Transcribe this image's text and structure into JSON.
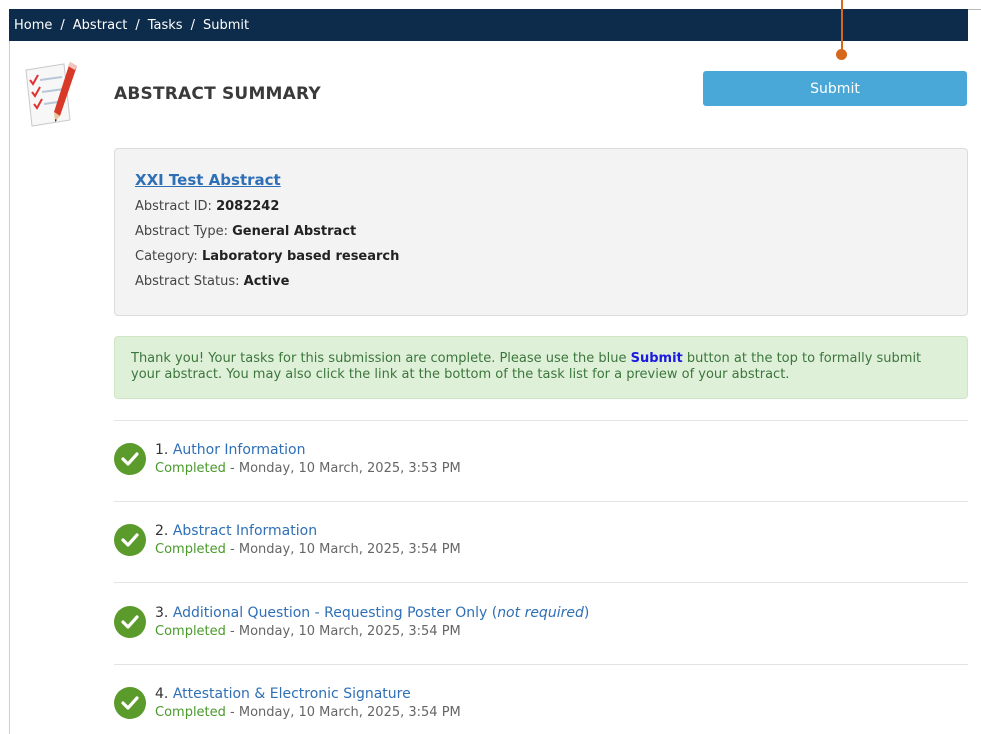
{
  "breadcrumb": [
    {
      "label": "Home"
    },
    {
      "label": "Abstract"
    },
    {
      "label": "Tasks"
    },
    {
      "label": "Submit"
    }
  ],
  "breadcrumb_separator": "/",
  "page_title": "ABSTRACT SUMMARY",
  "submit_button": "Submit",
  "summary": {
    "title_link": "XXI Test Abstract",
    "abstract_id_label": "Abstract ID:",
    "abstract_id": "2082242",
    "type_label": "Abstract Type:",
    "type": "General Abstract",
    "category_label": "Category:",
    "category": "Laboratory based research",
    "status_label": "Abstract Status:",
    "status": "Active"
  },
  "notice": {
    "before": "Thank you! Your tasks for this submission are complete. Please use the blue ",
    "highlight": "Submit",
    "after": " button at the top to formally submit your abstract. You may also click the link at the bottom of the task list for a preview of your abstract."
  },
  "tasks": [
    {
      "number": "1.",
      "label": "Author Information",
      "note": "",
      "status": "Completed",
      "date": "- Monday, 10 March, 2025, 3:53 PM"
    },
    {
      "number": "2.",
      "label": "Abstract Information",
      "note": "",
      "status": "Completed",
      "date": "- Monday, 10 March, 2025, 3:54 PM"
    },
    {
      "number": "3.",
      "label": "Additional Question - Requesting Poster Only",
      "note": "not required",
      "status": "Completed",
      "date": "- Monday, 10 March, 2025, 3:54 PM"
    },
    {
      "number": "4.",
      "label": "Attestation & Electronic Signature",
      "note": "",
      "status": "Completed",
      "date": "- Monday, 10 March, 2025, 3:54 PM"
    }
  ],
  "colors": {
    "topbar": "#0d2b4a",
    "submit_button": "#4aa8d8",
    "check_icon": "#5a9b2c",
    "link": "#2f6fb5",
    "callout": "#d4691c",
    "notice_bg": "#dff0d8"
  },
  "icons": {
    "page": "checklist-pencil-icon",
    "task_status": "check-circle-icon"
  }
}
